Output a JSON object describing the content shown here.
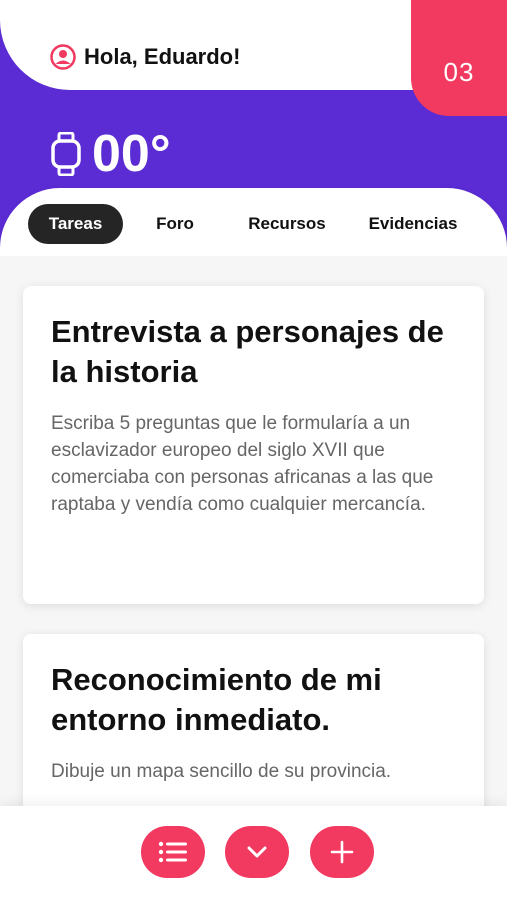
{
  "header": {
    "greeting": "Hola, Eduardo!",
    "badge_count": "03",
    "temperature": "00°",
    "icons": {
      "user": "user-circle-icon",
      "watch": "smartwatch-icon"
    }
  },
  "tabs": [
    {
      "label": "Tareas",
      "active": true
    },
    {
      "label": "Foro",
      "active": false
    },
    {
      "label": "Recursos",
      "active": false
    },
    {
      "label": "Evidencias",
      "active": false
    }
  ],
  "tasks": [
    {
      "title": "Entrevista a personajes de la historia",
      "description": "Escriba 5 preguntas que le formularía a un esclavizador europeo del siglo XVII que comerciaba con personas africanas a las que raptaba y vendía como cualquier mercancía."
    },
    {
      "title": "Reconocimiento de mi entorno inmediato.",
      "description": "Dibuje un mapa sencillo de su provincia."
    }
  ],
  "actions": {
    "icons": [
      "list-icon",
      "chevron-down-icon",
      "plus-icon"
    ]
  },
  "colors": {
    "primary_purple": "#5b2bd3",
    "accent_pink": "#f2395f",
    "tab_active": "#252525"
  }
}
